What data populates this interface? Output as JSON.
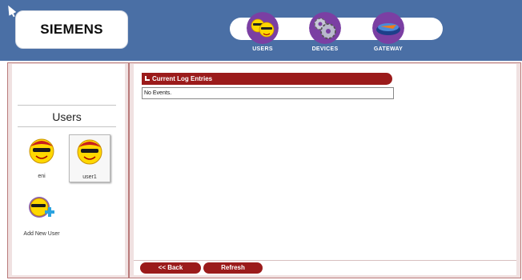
{
  "header": {
    "logo": "SIEMENS",
    "nav": [
      {
        "label": "USERS",
        "icon": "users-icon"
      },
      {
        "label": "DEVICES",
        "icon": "devices-icon"
      },
      {
        "label": "GATEWAY",
        "icon": "gateway-icon"
      }
    ]
  },
  "sidebar": {
    "title": "Users",
    "users": [
      {
        "label": "eni",
        "icon": "user-face-icon"
      },
      {
        "label": "user1",
        "icon": "user-face-icon",
        "selected": true
      }
    ],
    "add_user_label": "Add New User"
  },
  "log": {
    "title": "Current Log Entries",
    "entries_text": "No Events."
  },
  "footer": {
    "back_label": "<< Back",
    "refresh_label": "Refresh"
  },
  "colors": {
    "header_bg": "#4a6fa5",
    "accent": "#9b1b1b",
    "frame": "#f0e1e1"
  }
}
